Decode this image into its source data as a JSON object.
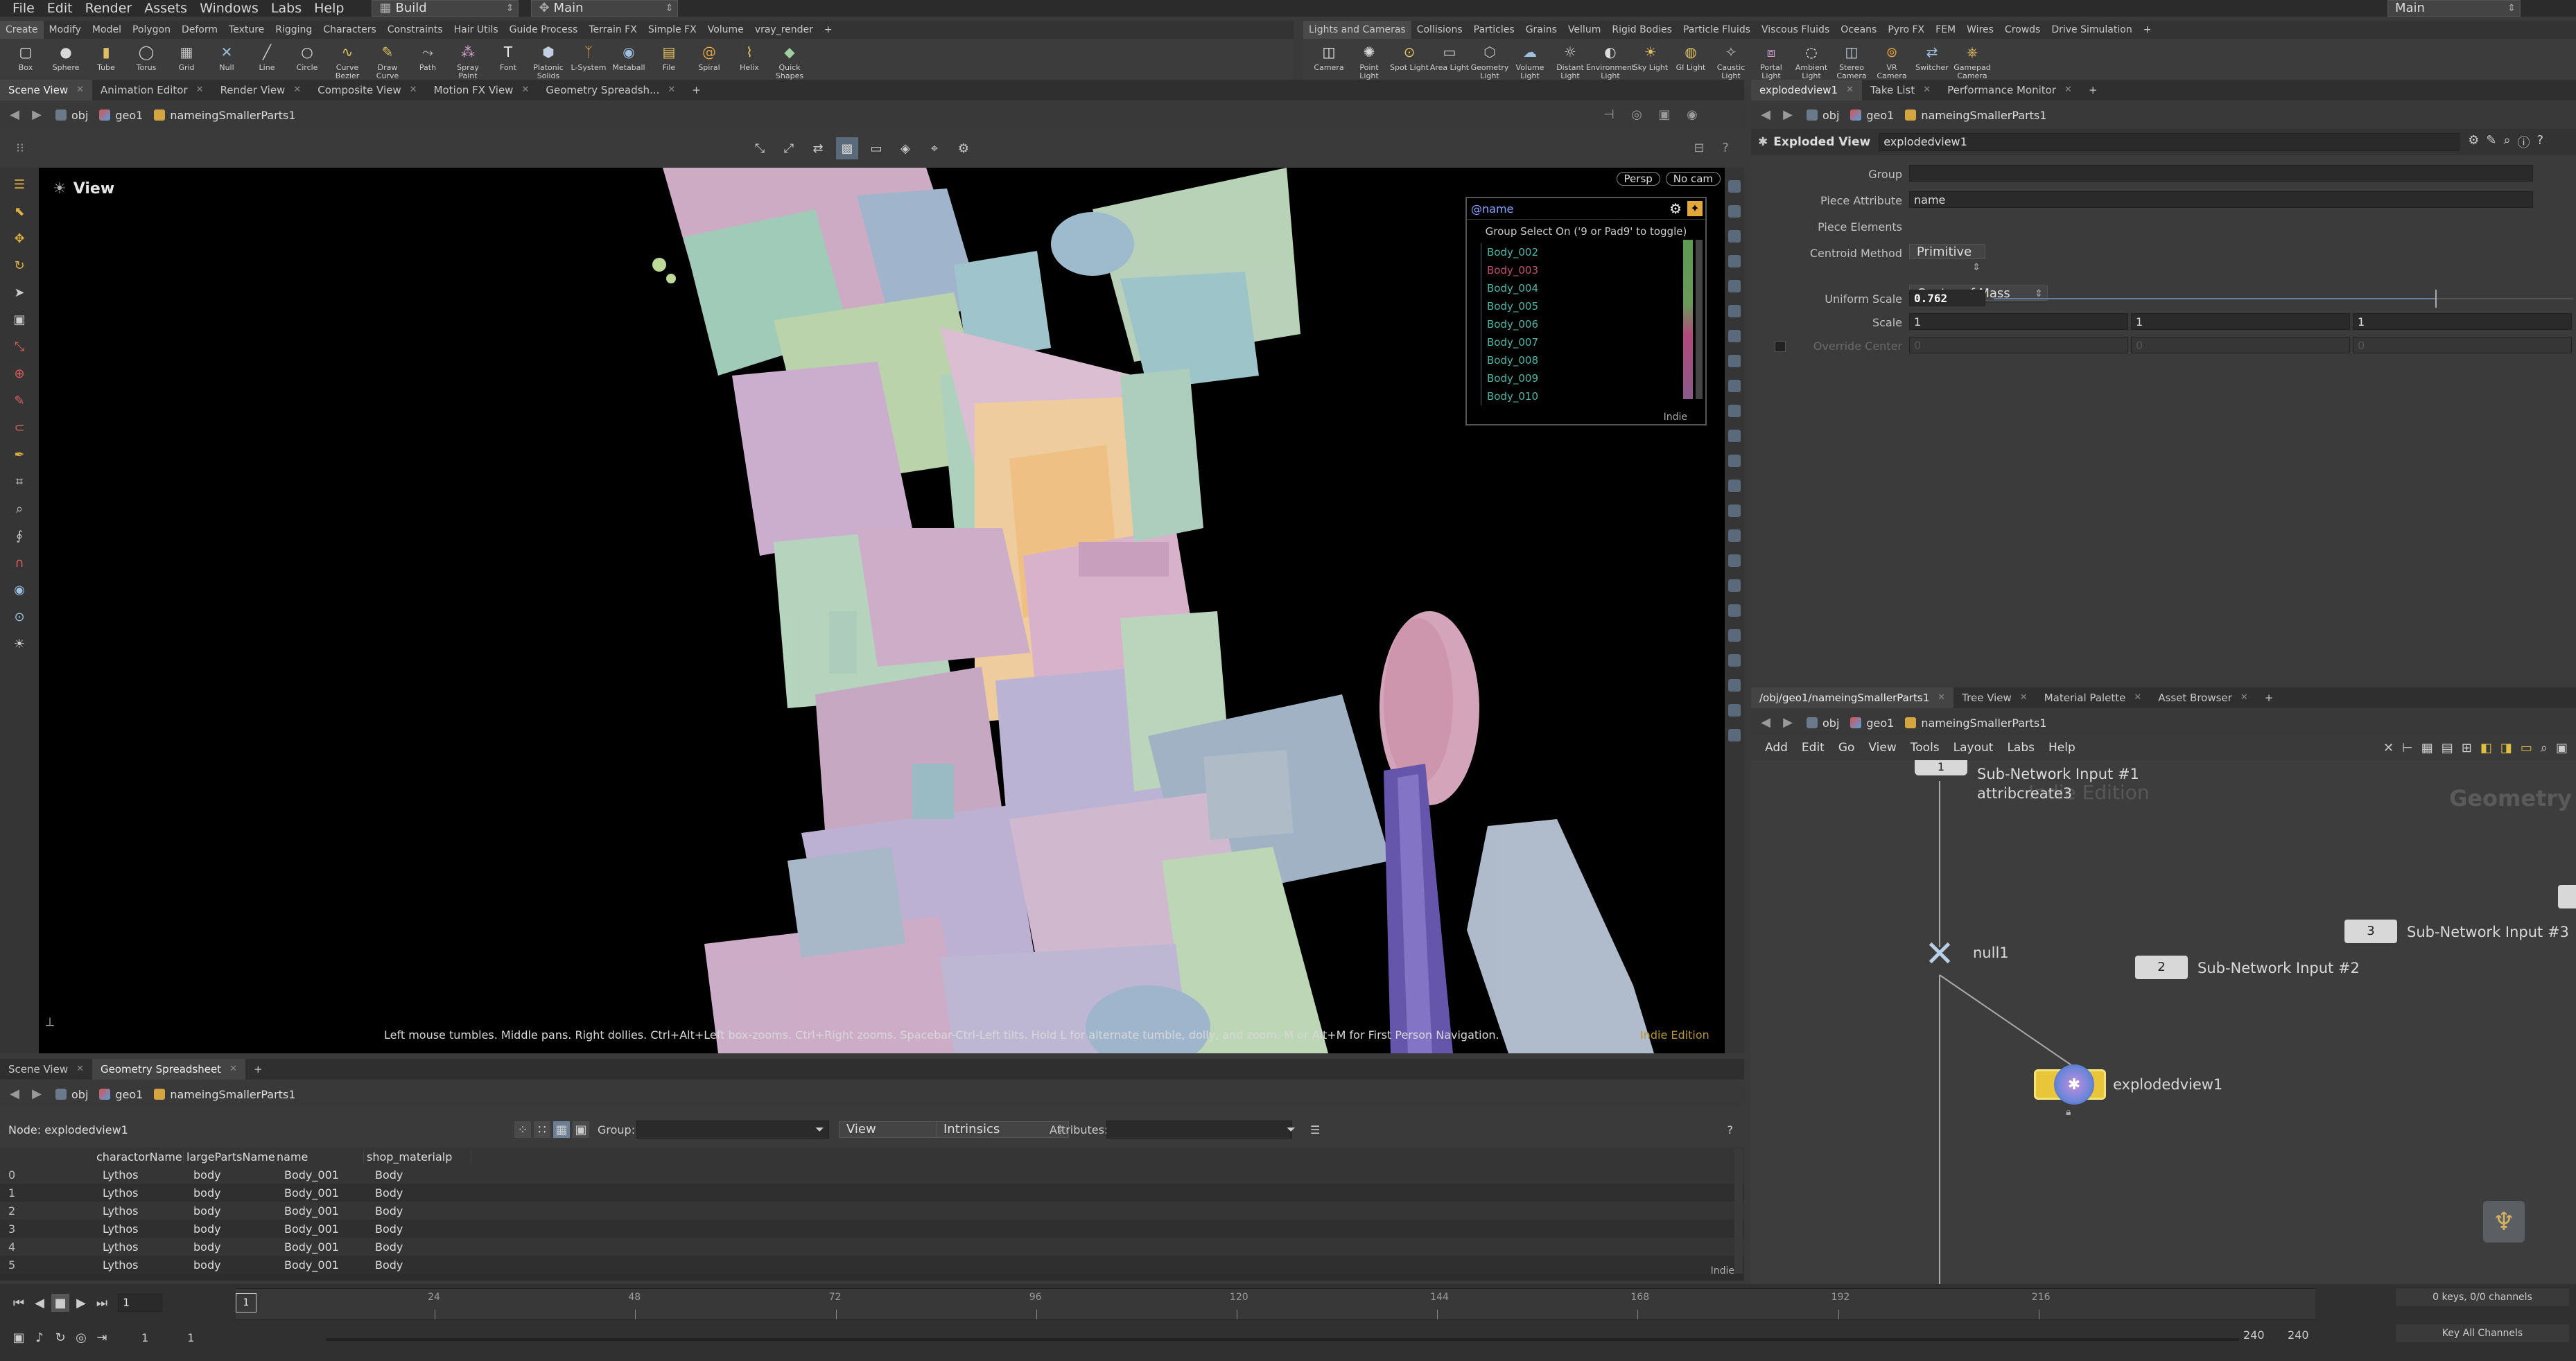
{
  "menubar": {
    "items": [
      "File",
      "Edit",
      "Render",
      "Assets",
      "Windows",
      "Labs",
      "Help"
    ],
    "desktop": "Build",
    "desktop_icon": "grid-icon",
    "context": "Main",
    "right_desktop": "Main"
  },
  "shelf_left": {
    "tabs": [
      "Create",
      "Modify",
      "Model",
      "Polygon",
      "Deform",
      "Texture",
      "Rigging",
      "Characters",
      "Constraints",
      "Hair Utils",
      "Guide Process",
      "Terrain FX",
      "Simple FX",
      "Volume",
      "vray_render"
    ],
    "tools": [
      "Box",
      "Sphere",
      "Tube",
      "Torus",
      "Grid",
      "Null",
      "Line",
      "Circle",
      "Curve Bezier",
      "Draw Curve",
      "Path",
      "Spray Paint",
      "Font",
      "Platonic Solids",
      "L-System",
      "Metaball",
      "File",
      "Spiral",
      "Helix",
      "Quick Shapes"
    ]
  },
  "shelf_right": {
    "tabs": [
      "Lights and Cameras",
      "Collisions",
      "Particles",
      "Grains",
      "Vellum",
      "Rigid Bodies",
      "Particle Fluids",
      "Viscous Fluids",
      "Oceans",
      "Pyro FX",
      "FEM",
      "Wires",
      "Crowds",
      "Drive Simulation"
    ],
    "tools": [
      "Camera",
      "Point Light",
      "Spot Light",
      "Area Light",
      "Geometry Light",
      "Volume Light",
      "Distant Light",
      "Environment Light",
      "Sky Light",
      "GI Light",
      "Caustic Light",
      "Portal Light",
      "Ambient Light",
      "Stereo Camera",
      "VR Camera",
      "Switcher",
      "Gamepad Camera"
    ]
  },
  "viewer_tabs": [
    "Scene View",
    "Animation Editor",
    "Render View",
    "Composite View",
    "Motion FX View",
    "Geometry Spreadsh..."
  ],
  "viewer_path": {
    "obj": "obj",
    "geo": "geo1",
    "node": "nameingSmallerParts1"
  },
  "viewport": {
    "title": "View",
    "persp": "Persp",
    "cam": "No cam",
    "hint": "Left mouse tumbles. Middle pans. Right dollies. Ctrl+Alt+Left box-zooms. Ctrl+Right zooms. Spacebar-Ctrl-Left tilts. Hold L for alternate tumble, dolly, and zoom. M or Alt+M for First Person Navigation.",
    "edition": "Indie Edition",
    "group_panel": {
      "attr": "@name",
      "subtitle": "Group Select On ('9 or Pad9' to toggle)",
      "items": [
        "Body_002",
        "Body_003",
        "Body_004",
        "Body_005",
        "Body_006",
        "Body_007",
        "Body_008",
        "Body_009",
        "Body_010"
      ],
      "item_colors": [
        "#4fb6a8",
        "#c0506e",
        "#4fb6a8",
        "#4fb6a8",
        "#4fb6a8",
        "#4fb6a8",
        "#4fb6a8",
        "#4fb6a8",
        "#4fb6a8"
      ],
      "footer": "Indie"
    }
  },
  "params_tabs": [
    "explodedview1",
    "Take List",
    "Performance Monitor"
  ],
  "params_path": {
    "obj": "obj",
    "geo": "geo1",
    "node": "nameingSmallerParts1"
  },
  "params": {
    "node_type": "Exploded View",
    "node_name": "explodedview1",
    "group_label": "Group",
    "group_value": "",
    "piece_attr_label": "Piece Attribute",
    "piece_attr_value": "name",
    "piece_elem_label": "Piece Elements",
    "piece_elem_value": "Primitive",
    "centroid_label": "Centroid Method",
    "centroid_value": "Center of Mass",
    "uniform_label": "Uniform Scale",
    "uniform_value": "0.762",
    "uniform_fraction": 0.762,
    "scale_label": "Scale",
    "scale_x": "1",
    "scale_y": "1",
    "scale_z": "1",
    "override_label": "Override Center",
    "override_x": "0",
    "override_y": "0",
    "override_z": "0"
  },
  "network_tabs": [
    "/obj/geo1/nameingSmallerParts1",
    "Tree View",
    "Material Palette",
    "Asset Browser"
  ],
  "network_path": {
    "obj": "obj",
    "geo": "geo1",
    "node": "nameingSmallerParts1"
  },
  "network_menu": [
    "Add",
    "Edit",
    "Go",
    "View",
    "Tools",
    "Layout",
    "Labs",
    "Help"
  ],
  "network": {
    "watermark": "Indie Edition",
    "context_label": "Geometry",
    "nodes": {
      "input1": {
        "num": "1",
        "label": "Sub-Network Input #1",
        "sub": "attribcreate3"
      },
      "input2": {
        "num": "2",
        "label": "Sub-Network Input #2"
      },
      "input3": {
        "num": "3",
        "label": "Sub-Network Input #3"
      },
      "null1": {
        "label": "null1"
      },
      "explode": {
        "label": "explodedview1"
      }
    }
  },
  "sheet_tabs": [
    "Scene View",
    "Geometry Spreadsheet"
  ],
  "sheet_path": {
    "obj": "obj",
    "geo": "geo1",
    "node": "nameingSmallerParts1"
  },
  "sheet": {
    "node_label": "Node: explodedview1",
    "group_label": "Group:",
    "view_label": "View",
    "intrinsics_label": "Intrinsics",
    "attributes_label": "Attributes:",
    "columns": [
      "",
      "charactorName",
      "largePartsName",
      "name",
      "shop_materialp"
    ],
    "rows": [
      [
        "0",
        "Lythos",
        "body",
        "Body_001",
        "Body"
      ],
      [
        "1",
        "Lythos",
        "body",
        "Body_001",
        "Body"
      ],
      [
        "2",
        "Lythos",
        "body",
        "Body_001",
        "Body"
      ],
      [
        "3",
        "Lythos",
        "body",
        "Body_001",
        "Body"
      ],
      [
        "4",
        "Lythos",
        "body",
        "Body_001",
        "Body"
      ],
      [
        "5",
        "Lythos",
        "body",
        "Body_001",
        "Body"
      ]
    ],
    "footer": "Indie"
  },
  "timeline": {
    "ticks": [
      "24",
      "48",
      "72",
      "96",
      "120",
      "144",
      "168",
      "192",
      "216"
    ],
    "current_frame": "1",
    "marker_frame": "1",
    "start": "1",
    "range_start": "1",
    "range_end": "240",
    "end": "240",
    "keys_label": "0 keys, 0/0 channels",
    "key_all": "Key All Channels"
  }
}
